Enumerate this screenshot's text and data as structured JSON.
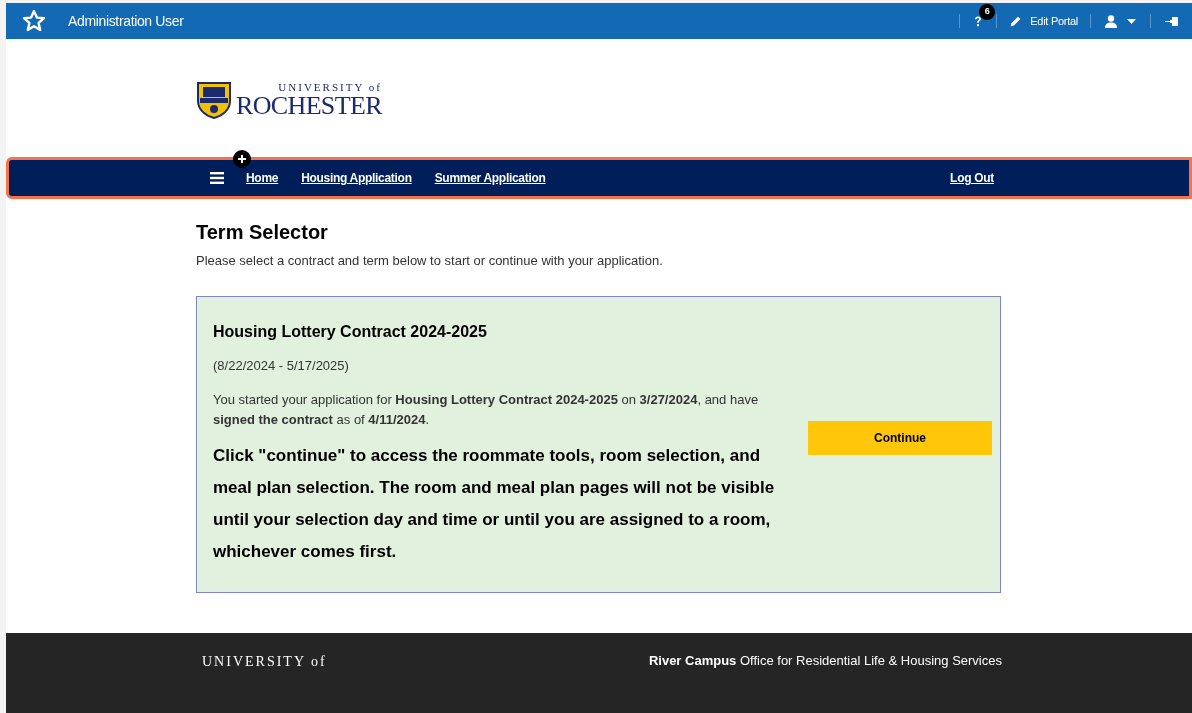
{
  "top_bar": {
    "title": "Administration User",
    "help_badge": "6",
    "edit_portal": "Edit Portal"
  },
  "logo": {
    "line_1": "UNIVERSITY of",
    "line_2": "ROCHESTER"
  },
  "nav": {
    "items": [
      {
        "label": "Home"
      },
      {
        "label": "Housing Application"
      },
      {
        "label": "Summer Application"
      }
    ],
    "logout": "Log Out"
  },
  "heading": "Term Selector",
  "intro": "Please select a contract and term below to start or continue with your application.",
  "contract": {
    "title": "Housing Lottery Contract 2024-2025",
    "dates": "(8/22/2024 - 5/17/2025)",
    "status": "You started your application for **Housing Lottery Contract 2024-2025** on **3/27/2024**, and have **signed the contract** as of **4/11/2024**.",
    "notice": "Click \"continue\" to access the roommate tools, room selection, and meal plan selection. The room and meal plan pages will not be visible until your selection day and time or until you are assigned to a room, whichever comes first.",
    "button": "Continue"
  },
  "footer": {
    "logo_line": "UNIVERSITY of",
    "office": "**River Campus** Office for Residential Life & Housing Services"
  }
}
